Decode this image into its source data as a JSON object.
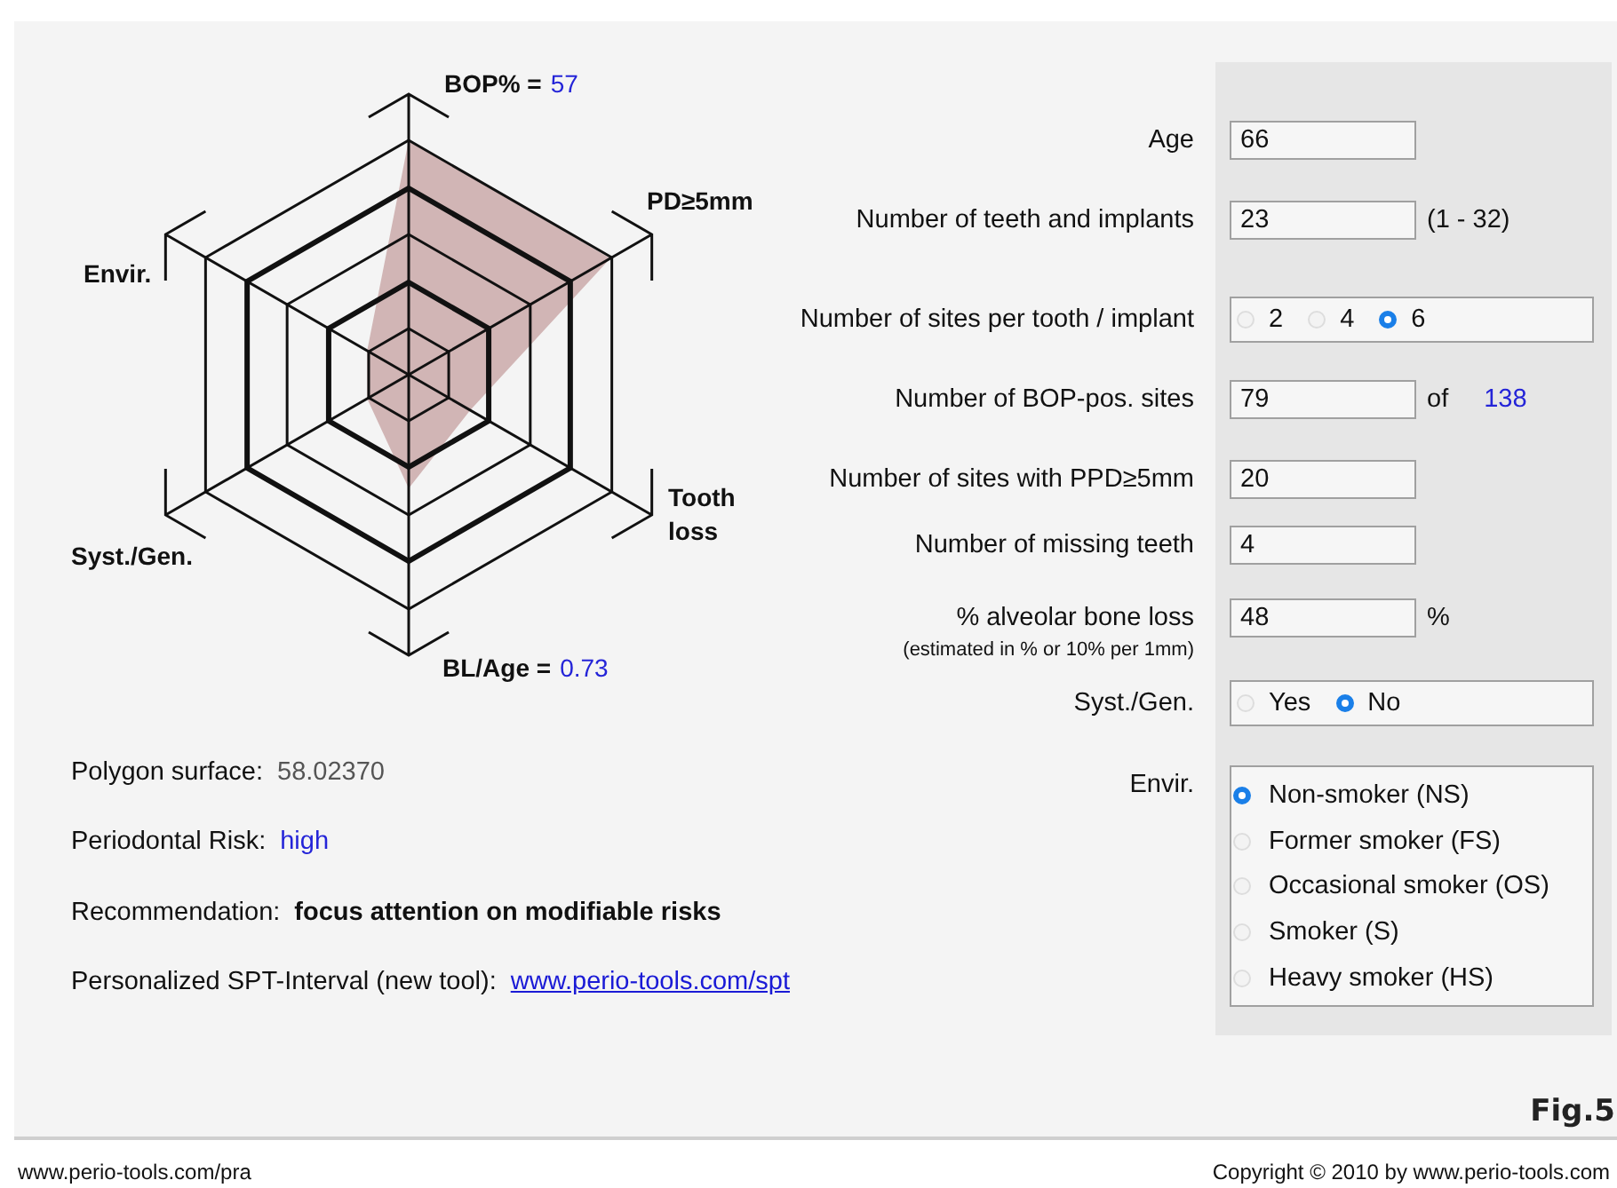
{
  "radar": {
    "axes": [
      {
        "lines": [
          "BOP% ="
        ],
        "value": "57"
      },
      {
        "lines": [
          "PD≥5mm"
        ]
      },
      {
        "lines": [
          "Tooth",
          "loss"
        ]
      },
      {
        "lines": [
          "BL/Age ="
        ],
        "value": "0.73"
      },
      {
        "lines": [
          "Syst./Gen."
        ]
      },
      {
        "lines": [
          "Envir."
        ]
      }
    ]
  },
  "results": [
    {
      "kind": "plain",
      "label": "Polygon surface:",
      "value": "58.02370"
    },
    {
      "kind": "risk",
      "label": "Periodontal Risk:",
      "value": "high"
    },
    {
      "kind": "bold",
      "label": "Recommendation:",
      "value": "focus attention on modifiable risks"
    },
    {
      "kind": "link",
      "label": "Personalized SPT-Interval (new tool):",
      "value": "www.perio-tools.com/spt"
    }
  ],
  "form": {
    "rows": [
      {
        "kind": "text",
        "label": "Age",
        "value": "66"
      },
      {
        "kind": "text",
        "label": "Number of teeth and implants",
        "value": "23",
        "suffix": "(1 - 32)"
      },
      {
        "kind": "radio",
        "label": "Number of sites per tooth / implant",
        "options": [
          {
            "label": "2",
            "selected": false
          },
          {
            "label": "4",
            "selected": false
          },
          {
            "label": "6",
            "selected": true
          }
        ]
      },
      {
        "kind": "text",
        "label": "Number of BOP-pos. sites",
        "value": "79",
        "suffix": "of",
        "extra": "138"
      },
      {
        "kind": "text",
        "label": "Number of sites with PPD≥5mm",
        "value": "20"
      },
      {
        "kind": "text",
        "label": "Number of missing teeth",
        "value": "4"
      },
      {
        "kind": "text",
        "label": "% alveolar bone loss",
        "note": "(estimated in % or 10% per 1mm)",
        "value": "48",
        "suffix": "%"
      },
      {
        "kind": "radio",
        "label": "Syst./Gen.",
        "options": [
          {
            "label": "Yes",
            "selected": false
          },
          {
            "label": "No",
            "selected": true
          }
        ]
      },
      {
        "kind": "radiolist",
        "label": "Envir.",
        "options": [
          {
            "label": "Non-smoker (NS)",
            "selected": true
          },
          {
            "label": "Former smoker (FS)",
            "selected": false
          },
          {
            "label": "Occasional smoker (OS)",
            "selected": false
          },
          {
            "label": "Smoker (S)",
            "selected": false
          },
          {
            "label": "Heavy smoker (HS)",
            "selected": false
          }
        ]
      }
    ]
  },
  "figure_label": "Fig.5",
  "footer": {
    "left": "www.perio-tools.com/pra",
    "right": "Copyright © 2010 by www.perio-tools.com"
  }
}
